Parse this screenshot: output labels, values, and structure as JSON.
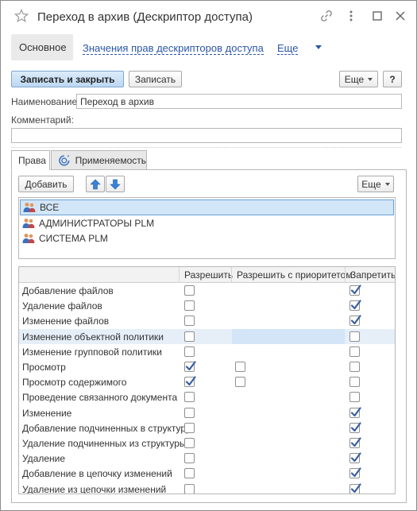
{
  "window": {
    "title": "Переход в архив (Дескриптор доступа)"
  },
  "nav": {
    "main": "Основное",
    "link_values": "Значения прав дескрипторов доступа",
    "link_more": "Еще"
  },
  "toolbar": {
    "save_close": "Записать и закрыть",
    "save": "Записать",
    "more": "Еще",
    "help": "?"
  },
  "form": {
    "name_label": "Наименование:",
    "name_value": "Переход в архив",
    "comment_label": "Комментарий:",
    "comment_value": ""
  },
  "tabs": {
    "rights": "Права",
    "applicability": "Применяемость"
  },
  "rights_toolbar": {
    "add": "Добавить",
    "more": "Еще"
  },
  "groups": [
    {
      "label": "ВСЕ",
      "selected": true
    },
    {
      "label": "АДМИНИСТРАТОРЫ PLM",
      "selected": false
    },
    {
      "label": "СИСТЕМА PLM",
      "selected": false
    }
  ],
  "rights_table": {
    "columns": [
      "",
      "Разрешить",
      "Разрешить с приоритетом",
      "Запретить"
    ],
    "rows": [
      {
        "name": "Добавление файлов",
        "allow": false,
        "priority": null,
        "deny": true
      },
      {
        "name": "Удаление файлов",
        "allow": false,
        "priority": null,
        "deny": true
      },
      {
        "name": "Изменение файлов",
        "allow": false,
        "priority": null,
        "deny": true
      },
      {
        "name": "Изменение объектной политики",
        "allow": false,
        "priority": null,
        "deny": false,
        "highlighted": true
      },
      {
        "name": "Изменение групповой политики",
        "allow": false,
        "priority": null,
        "deny": false
      },
      {
        "name": "Просмотр",
        "allow": true,
        "priority": false,
        "deny": false
      },
      {
        "name": "Просмотр содержимого",
        "allow": true,
        "priority": false,
        "deny": false
      },
      {
        "name": "Проведение связанного документа",
        "allow": false,
        "priority": null,
        "deny": false
      },
      {
        "name": "Изменение",
        "allow": false,
        "priority": null,
        "deny": true
      },
      {
        "name": "Добавление подчиненных в структуру",
        "allow": false,
        "priority": null,
        "deny": true
      },
      {
        "name": "Удаление подчиненных из структуры",
        "allow": false,
        "priority": null,
        "deny": true
      },
      {
        "name": "Удаление",
        "allow": false,
        "priority": null,
        "deny": true
      },
      {
        "name": "Добавление в цепочку изменений",
        "allow": false,
        "priority": null,
        "deny": true
      },
      {
        "name": "Удаление из цепочки изменений",
        "allow": false,
        "priority": null,
        "deny": true
      }
    ]
  },
  "icons": {
    "favorite": "star-icon",
    "link": "link-icon",
    "more_vertical": "more-vertical-icon",
    "maximize": "maximize-icon",
    "close": "close-icon",
    "applicability": "applicability-icon",
    "move_up": "arrow-up-icon",
    "move_down": "arrow-down-icon",
    "group": "users-group-icon",
    "check": "checkmark-icon"
  },
  "colors": {
    "link": "#2b56a8",
    "primary_button": "#bdd8f3",
    "selection": "#d2e6f8",
    "check": "#3a5fa0"
  }
}
